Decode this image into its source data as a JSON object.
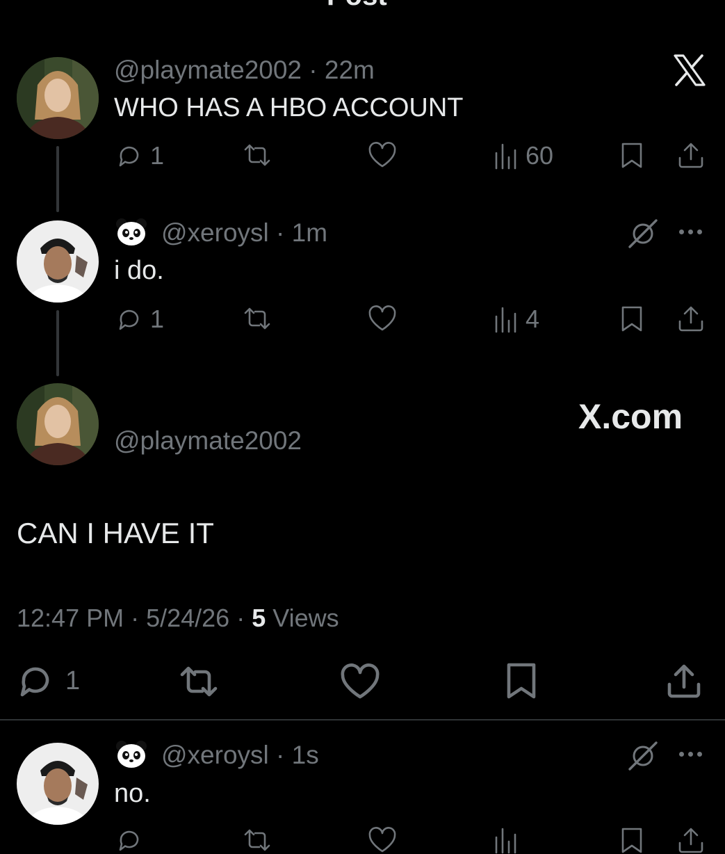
{
  "header": {
    "title": "Post"
  },
  "watermark": {
    "text": "X.com"
  },
  "posts": [
    {
      "username": "@playmate2002",
      "time": "22m",
      "text": "WHO HAS A HBO ACCOUNT",
      "replies": "1",
      "views": "60",
      "avatar_icon": "avatar-woman",
      "corner_icon": "x-logo-icon"
    },
    {
      "username": "@xeroysl",
      "time": "1m",
      "text": "i do.",
      "replies": "1",
      "views": "4",
      "avatar_icon": "avatar-man",
      "badge_icon": "panda-emoji"
    },
    {
      "username": "@xeroysl",
      "time": "1s",
      "text": "no.",
      "avatar_icon": "avatar-man",
      "badge_icon": "panda-emoji"
    }
  ],
  "focused_post": {
    "username": "@playmate2002",
    "text": "CAN I HAVE IT",
    "time": "12:47 PM",
    "date": "5/24/26",
    "views_count": "5",
    "views_label": "Views",
    "replies": "1"
  },
  "colors": {
    "background": "#000000",
    "text": "#e7e9ea",
    "muted": "#71767b",
    "divider": "#2f3336"
  }
}
